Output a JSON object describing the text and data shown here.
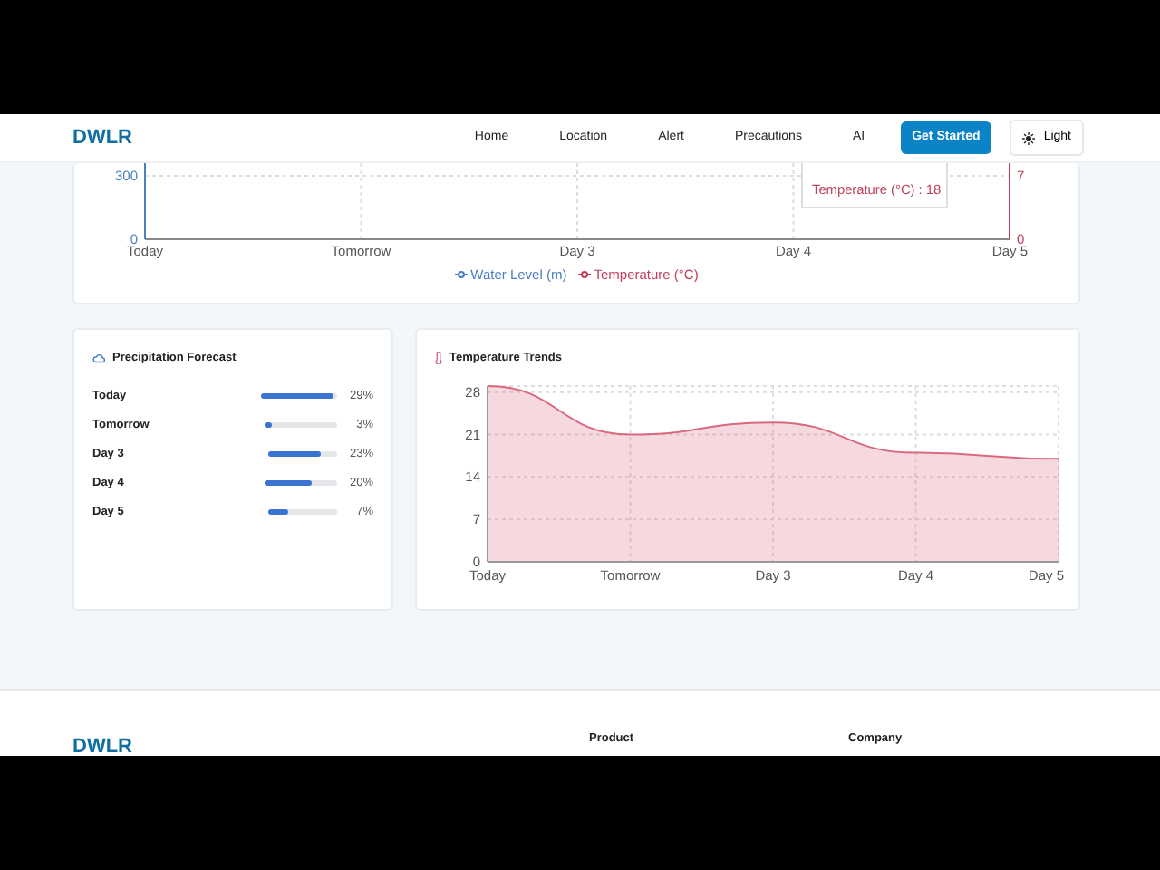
{
  "navbar": {
    "brand": "DWLR",
    "links": [
      {
        "label": "Home"
      },
      {
        "label": "Location"
      },
      {
        "label": "Alert"
      },
      {
        "label": "Precautions"
      },
      {
        "label": "AI"
      }
    ],
    "cta": "Get Started",
    "theme_toggle": "Light"
  },
  "water_chart": {
    "left_ticks": [
      "300",
      "0"
    ],
    "right_ticks": [
      "7",
      "0"
    ],
    "categories": [
      "Today",
      "Tomorrow",
      "Day 3",
      "Day 4",
      "Day 5"
    ],
    "legend": [
      {
        "label": "Water Level (m)",
        "color": "#4a7fc1"
      },
      {
        "label": "Temperature (°C)",
        "color": "#c0405a"
      }
    ],
    "tooltip": "Temperature (°C) : 18"
  },
  "precipitation": {
    "title": "Precipitation Forecast",
    "rows": [
      {
        "day": "Today",
        "level": 0.96,
        "percent": "29%"
      },
      {
        "day": "Tomorrow",
        "level": 0.1,
        "percent": "3%"
      },
      {
        "day": "Day 3",
        "level": 0.75,
        "percent": "23%"
      },
      {
        "day": "Day 4",
        "level": 0.65,
        "percent": "20%"
      },
      {
        "day": "Day 5",
        "level": 0.3,
        "percent": "7%"
      }
    ]
  },
  "temperature": {
    "title": "Temperature Trends",
    "chart_data": {
      "type": "area",
      "categories": [
        "Today",
        "Tomorrow",
        "Day 3",
        "Day 4",
        "Day 5"
      ],
      "series": [
        {
          "color": "#d9697f",
          "values": [
            29,
            21,
            23,
            18,
            17
          ]
        }
      ],
      "ylim": [
        0,
        29
      ],
      "yticks": [
        0,
        7,
        14,
        21,
        28
      ],
      "grid": true
    }
  },
  "footer": {
    "brand": "DWLR",
    "headings": [
      "Product",
      "Company"
    ]
  }
}
